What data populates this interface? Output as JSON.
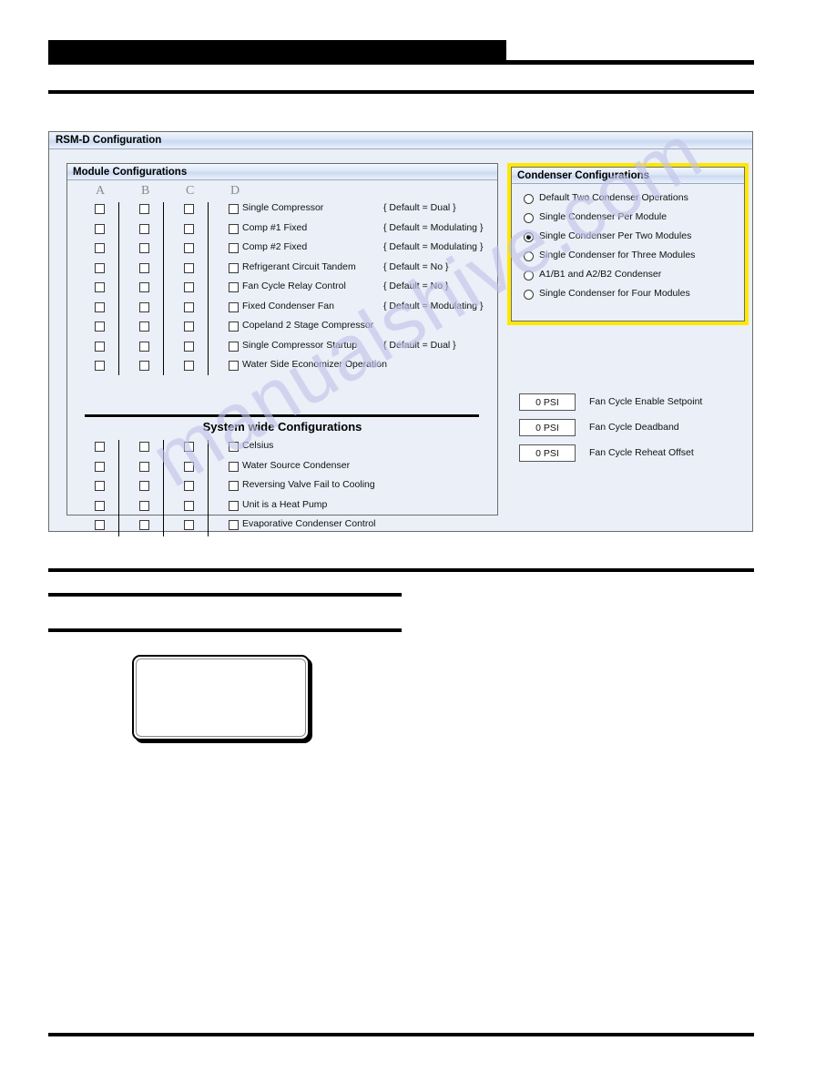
{
  "page": {
    "watermark": "manualshive.com",
    "redacted_header": ""
  },
  "dialog": {
    "title": "RSM-D Configuration"
  },
  "module_panel": {
    "title": "Module Configurations",
    "columns": [
      "A",
      "B",
      "C",
      "D"
    ],
    "rows": [
      {
        "label": "Single Compressor",
        "default": "{ Default = Dual }"
      },
      {
        "label": "Comp #1 Fixed",
        "default": "{ Default = Modulating }"
      },
      {
        "label": "Comp #2 Fixed",
        "default": "{ Default = Modulating }"
      },
      {
        "label": "Refrigerant Circuit Tandem",
        "default": "{ Default = No }"
      },
      {
        "label": "Fan Cycle Relay Control",
        "default": "{ Default = No }"
      },
      {
        "label": "Fixed Condenser Fan",
        "default": "{ Default = Modulating }"
      },
      {
        "label": "Copeland 2 Stage Compressor",
        "default": ""
      },
      {
        "label": "Single Compressor Startup",
        "default": "{ Default = Dual }"
      },
      {
        "label": "Water Side Economizer Operation",
        "default": ""
      }
    ]
  },
  "system_wide": {
    "title": "System wide Configurations",
    "rows": [
      {
        "label": "Celsius"
      },
      {
        "label": "Water Source Condenser"
      },
      {
        "label": "Reversing Valve Fail to Cooling"
      },
      {
        "label": "Unit is a Heat Pump"
      },
      {
        "label": "Evaporative Condenser Control"
      }
    ]
  },
  "condenser_panel": {
    "title": "Condenser Configurations",
    "highlight_color": "#ffe800",
    "options": [
      {
        "label": "Default Two Condenser Operations",
        "selected": false
      },
      {
        "label": "Single Condenser Per Module",
        "selected": false
      },
      {
        "label": "Single Condenser Per Two Modules",
        "selected": true
      },
      {
        "label": "Single Condenser for Three Modules",
        "selected": false
      },
      {
        "label": "A1/B1 and A2/B2 Condenser",
        "selected": false
      },
      {
        "label": "Single Condenser for Four Modules",
        "selected": false
      }
    ]
  },
  "setpoints": [
    {
      "value": "0 PSI",
      "label": "Fan Cycle Enable Setpoint"
    },
    {
      "value": "0 PSI",
      "label": "Fan Cycle Deadband"
    },
    {
      "value": "0 PSI",
      "label": "Fan Cycle Reheat Offset"
    }
  ]
}
